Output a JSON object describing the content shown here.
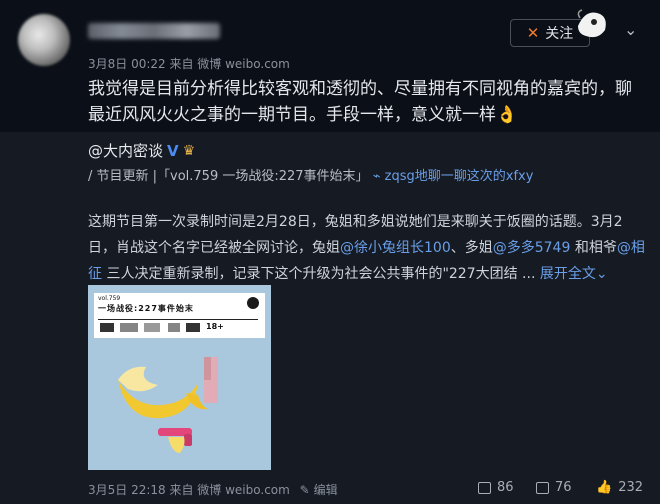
{
  "post": {
    "username": "",
    "time": "3月8日 00:22 来自 微博 weibo.com",
    "follow_label": "关注",
    "text": "我觉得是目前分析得比较客观和透彻的、尽量拥有不同视角的嘉宾的，聊最近风风火火之事的一期节目。手段一样，意义就一样👌"
  },
  "repost": {
    "author": "@大内密谈",
    "topic_prefix": "/ 节目更新 |「vol.759 一场战役:227事件始末」",
    "topic_link": "zqsg地聊一聊这次的xfxy",
    "body_plain_1": "这期节目第一次录制时间是2月28日，兔姐和多姐说她们是来聊关于饭圈的话题。3月2日，肖战这个名字已经被全网讨论，兔姐",
    "mention_1": "@徐小兔组长100",
    "body_plain_2": "、多姐",
    "mention_2": "@多多5749",
    "body_plain_3": " 和相爷",
    "mention_3": "@相征",
    "body_plain_4": " 三人决定重新录制，记录下这个升级为社会公共事件的\"227大团结 ...",
    "expand_label": "展开全文",
    "poster": {
      "vol": "vol.759",
      "title": "一场战役:227事件始末",
      "rating": "18+"
    },
    "footer_time": "3月5日 22:18 来自 微博 weibo.com",
    "edit_label": "编辑",
    "share_count": "86",
    "comment_count": "76",
    "like_count": "232"
  }
}
